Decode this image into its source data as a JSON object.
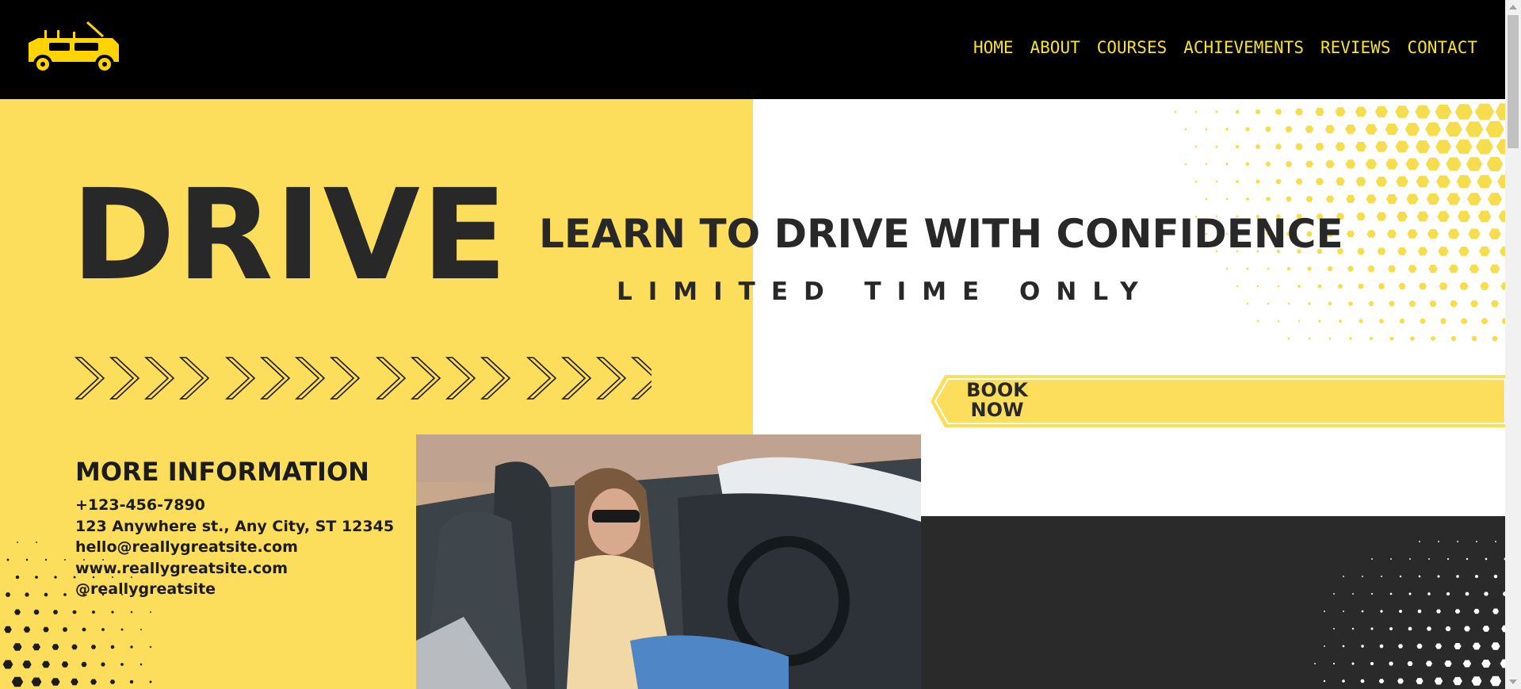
{
  "nav": {
    "items": [
      {
        "label": "HOME"
      },
      {
        "label": "ABOUT"
      },
      {
        "label": "COURSES"
      },
      {
        "label": "ACHIEVEMENTS"
      },
      {
        "label": "REVIEWS"
      },
      {
        "label": "CONTACT"
      }
    ],
    "color": "#f7e22b"
  },
  "logo": {
    "icon": "jeep-car-icon",
    "color": "#ffd400"
  },
  "hero": {
    "big_word": "DRIVE",
    "headline": "LEARN TO DRIVE WITH CONFIDENCE",
    "subline": "LIMITED TIME ONLY",
    "cta_label": "BOOK\nNOW",
    "arrows_icon": "chevron-right-icon"
  },
  "info": {
    "title": "MORE INFORMATION",
    "lines": [
      "+123-456-7890",
      "123 Anywhere st., Any City, ST 12345",
      "hello@reallygreatsite.com",
      "www.reallygreatsite.com",
      "@reallygreatsite"
    ]
  },
  "colors": {
    "yellow": "#fddd5c",
    "dark": "#2a2a2a",
    "text": "#282828",
    "topbar": "#000000"
  }
}
